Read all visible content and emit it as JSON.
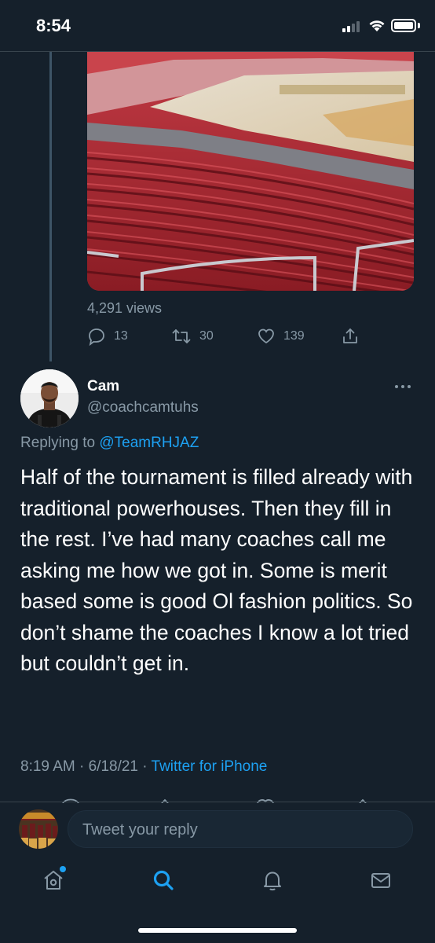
{
  "status_bar": {
    "time": "8:54"
  },
  "parent_tweet": {
    "views": "4,291 views",
    "reply_count": "13",
    "retweet_count": "30",
    "like_count": "139"
  },
  "tweet": {
    "author_name": "Cam",
    "author_handle": "@coachcamtuhs",
    "replying_prefix": "Replying to",
    "replying_to": "@TeamRHJAZ",
    "text": "Half of the tournament is filled already with traditional powerhouses. Then they fill in the rest. I’ve had many coaches call me asking me how we got in.  Some is merit based some is good Ol fashion politics.  So don’t shame the coaches I know a lot tried but couldn’t get in.",
    "timestamp": "8:19 AM · 6/18/21 · ",
    "source": "Twitter for iPhone"
  },
  "reply_composer": {
    "placeholder": "Tweet your reply"
  },
  "tab_bar": {
    "items": [
      "home",
      "search",
      "notifications",
      "messages"
    ]
  },
  "colors": {
    "background": "#15202b",
    "accent": "#1da1f2",
    "secondary_text": "#8899a6",
    "divider": "#38444d"
  }
}
